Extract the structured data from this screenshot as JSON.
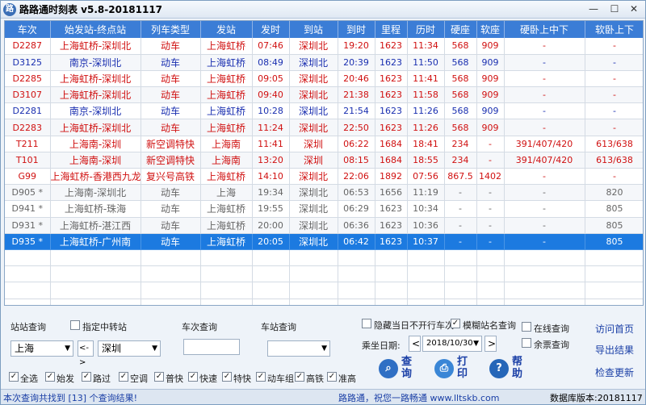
{
  "window": {
    "title": "路路通时刻表 v5.8-20181117",
    "min": "—",
    "max": "☐",
    "close": "✕"
  },
  "table": {
    "headers": [
      "车次",
      "始发站-终点站",
      "列车类型",
      "发站",
      "发时",
      "到站",
      "到时",
      "里程",
      "历时",
      "硬座",
      "软座",
      "硬卧上中下",
      "软卧上下"
    ],
    "rows": [
      {
        "style": "red",
        "cells": [
          "D2287",
          "上海虹桥-深圳北",
          "动车",
          "上海虹桥",
          "07:46",
          "深圳北",
          "19:20",
          "1623",
          "11:34",
          "568",
          "909",
          "-",
          "-"
        ]
      },
      {
        "style": "blue",
        "cells": [
          "D3125",
          "南京-深圳北",
          "动车",
          "上海虹桥",
          "08:49",
          "深圳北",
          "20:39",
          "1623",
          "11:50",
          "568",
          "909",
          "-",
          "-"
        ]
      },
      {
        "style": "red",
        "cells": [
          "D2285",
          "上海虹桥-深圳北",
          "动车",
          "上海虹桥",
          "09:05",
          "深圳北",
          "20:46",
          "1623",
          "11:41",
          "568",
          "909",
          "-",
          "-"
        ]
      },
      {
        "style": "red",
        "cells": [
          "D3107",
          "上海虹桥-深圳北",
          "动车",
          "上海虹桥",
          "09:40",
          "深圳北",
          "21:38",
          "1623",
          "11:58",
          "568",
          "909",
          "-",
          "-"
        ]
      },
      {
        "style": "blue",
        "cells": [
          "D2281",
          "南京-深圳北",
          "动车",
          "上海虹桥",
          "10:28",
          "深圳北",
          "21:54",
          "1623",
          "11:26",
          "568",
          "909",
          "-",
          "-"
        ]
      },
      {
        "style": "red",
        "cells": [
          "D2283",
          "上海虹桥-深圳北",
          "动车",
          "上海虹桥",
          "11:24",
          "深圳北",
          "22:50",
          "1623",
          "11:26",
          "568",
          "909",
          "-",
          "-"
        ]
      },
      {
        "style": "red",
        "cells": [
          "T211",
          "上海南-深圳",
          "新空调特快",
          "上海南",
          "11:41",
          "深圳",
          "06:22",
          "1684",
          "18:41",
          "234",
          "-",
          "391/407/420",
          "613/638"
        ]
      },
      {
        "style": "red",
        "cells": [
          "T101",
          "上海南-深圳",
          "新空调特快",
          "上海南",
          "13:20",
          "深圳",
          "08:15",
          "1684",
          "18:55",
          "234",
          "-",
          "391/407/420",
          "613/638"
        ]
      },
      {
        "style": "red",
        "cells": [
          "G99",
          "上海虹桥-香港西九龙",
          "复兴号高铁",
          "上海虹桥",
          "14:10",
          "深圳北",
          "22:06",
          "1892",
          "07:56",
          "867.5",
          "1402",
          "-",
          "-"
        ]
      },
      {
        "style": "gray",
        "cells": [
          "D905 *",
          "上海南-深圳北",
          "动车",
          "上海",
          "19:34",
          "深圳北",
          "06:53",
          "1656",
          "11:19",
          "-",
          "-",
          "-",
          "820"
        ]
      },
      {
        "style": "gray",
        "cells": [
          "D941 *",
          "上海虹桥-珠海",
          "动车",
          "上海虹桥",
          "19:55",
          "深圳北",
          "06:29",
          "1623",
          "10:34",
          "-",
          "-",
          "-",
          "805"
        ]
      },
      {
        "style": "gray",
        "cells": [
          "D931 *",
          "上海虹桥-湛江西",
          "动车",
          "上海虹桥",
          "20:00",
          "深圳北",
          "06:36",
          "1623",
          "10:36",
          "-",
          "-",
          "-",
          "805"
        ]
      },
      {
        "style": "sel",
        "cells": [
          "D935 *",
          "上海虹桥-广州南",
          "动车",
          "上海虹桥",
          "20:05",
          "深圳北",
          "06:42",
          "1623",
          "10:37",
          "-",
          "-",
          "-",
          "805"
        ]
      }
    ]
  },
  "query": {
    "station_label": "站站查询",
    "via_label": "指定中转站",
    "from": "上海",
    "swap": "<->",
    "to": "深圳",
    "train_label": "车次查询",
    "station_only_label": "车站查询",
    "hide_label": "隐藏当日不开行车次",
    "fuzzy_label": "模糊站名查询",
    "date_label": "乘坐日期:",
    "date_value": "2018/10/30",
    "prev": "<",
    "next": ">",
    "online_label": "在线查询",
    "remain_label": "余票查询"
  },
  "filters": [
    "全选",
    "始发",
    "路过",
    "空调",
    "普快",
    "快速",
    "特快",
    "动车组",
    "高铁",
    "准高"
  ],
  "buttons": {
    "query": "查询",
    "print": "打印",
    "help": "帮助"
  },
  "links": {
    "home": "访问首页",
    "export": "导出结果",
    "update": "检查更新"
  },
  "status": {
    "left": "本次查询共找到 [13] 个查询结果!",
    "mid": "路路通，祝您一路畅通 www.lltskb.com",
    "right": "数据库版本:20181117"
  }
}
